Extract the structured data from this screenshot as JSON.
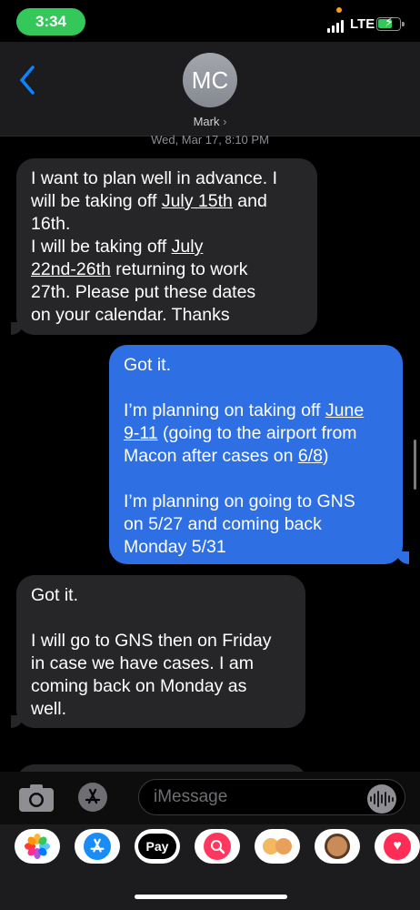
{
  "status_bar": {
    "time": "3:34",
    "network": "LTE",
    "signal_bars": 4,
    "battery_level": 0.6,
    "battery_color": "#34c759",
    "charging": true
  },
  "header": {
    "back_icon": "chevron-left-icon",
    "avatar_initials": "MC",
    "contact_name": "Mark",
    "contact_chevron": "›"
  },
  "timestamp": "Wed, Mar 17, 8:10 PM",
  "messages": [
    {
      "direction": "incoming",
      "lines": [
        "I want to plan well in advance.  I",
        "will be taking off ",
        "July 15th",
        " and",
        "16th.",
        "I will be taking off ",
        "July",
        "22nd-26th",
        " returning to work",
        "27th.  Please put these dates",
        "on your calendar.  Thanks"
      ]
    },
    {
      "direction": "outgoing",
      "lines": [
        "Got it.",
        "I’m planning on taking off ",
        "June",
        "9-11",
        " (going to the airport from",
        "Macon after cases on ",
        "6/8",
        ")",
        "I’m planning on going to GNS",
        "on 5/27 and coming back",
        "Monday 5/31"
      ]
    },
    {
      "direction": "incoming",
      "lines": [
        "Got it.",
        "I will go to GNS then on Friday",
        "in case we have cases.  I am",
        "coming back on Monday as",
        "well."
      ]
    }
  ],
  "input_bar": {
    "camera_icon": "camera-icon",
    "apps_icon": "app-store-icon",
    "placeholder": "iMessage",
    "audio_icon": "audio-waveform-icon"
  },
  "app_drawer": {
    "apps": [
      {
        "name": "photos-app",
        "icon": "photos-icon",
        "label": ""
      },
      {
        "name": "app-store-app",
        "icon": "app-store-icon",
        "label": ""
      },
      {
        "name": "apple-pay-app",
        "icon": "apple-pay-icon",
        "label": "Pay"
      },
      {
        "name": "search-images-app",
        "icon": "globe-search-icon",
        "label": ""
      },
      {
        "name": "memoji-stickers-app",
        "icon": "memoji-icon",
        "label": ""
      },
      {
        "name": "animoji-app",
        "icon": "animoji-icon",
        "label": ""
      },
      {
        "name": "digital-touch-app",
        "icon": "heart-touch-icon",
        "label": ""
      }
    ]
  },
  "colors": {
    "incoming_bubble": "#262628",
    "outgoing_bubble": "#2e6fe3",
    "accent": "#0a84ff"
  }
}
